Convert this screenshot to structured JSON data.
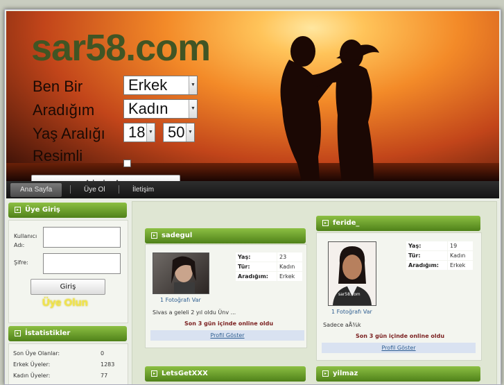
{
  "site": {
    "logo": "sar58.com"
  },
  "search": {
    "ben_bir_label": "Ben Bir",
    "ben_bir_value": "Erkek",
    "aradigim_label": "Aradığım",
    "aradigim_value": "Kadın",
    "yas_label": "Yaş Aralığı",
    "yas_min": "18",
    "yas_max": "50",
    "resimli_label": "Resimli",
    "button_label": "Arkadaş Ara"
  },
  "nav": {
    "items": [
      {
        "label": "Ana Sayfa"
      },
      {
        "label": "Üye Ol"
      },
      {
        "label": "İletişim"
      }
    ]
  },
  "login": {
    "title": "Üye Giriş",
    "username_label": "Kullanıcı Adı:",
    "password_label": "Şifre:",
    "button_label": "Giriş",
    "signup_link": "Üye Olun"
  },
  "stats": {
    "title": "İstatistikler",
    "rows": [
      {
        "label": "Son Üye Olanlar:",
        "value": "0"
      },
      {
        "label": "Erkek Üyeler:",
        "value": "1283"
      },
      {
        "label": "Kadın Üyeler:",
        "value": "77"
      }
    ]
  },
  "profiles": [
    {
      "name": "sadegul",
      "photo_count": "1 Fotoğrafı Var",
      "info": [
        {
          "k": "Yaş:",
          "v": "23"
        },
        {
          "k": "Tür:",
          "v": "Kadın"
        },
        {
          "k": "Aradığım:",
          "v": "Erkek"
        }
      ],
      "bio": "Sivas a geleli 2 yıl oldu Ünv ...",
      "online": "Son 3 gün içinde online oldu",
      "profile_link": "Profil Göster"
    },
    {
      "name": "feride_",
      "photo_count": "1 Fotoğrafı Var",
      "info": [
        {
          "k": "Yaş:",
          "v": "19"
        },
        {
          "k": "Tür:",
          "v": "Kadın"
        },
        {
          "k": "Aradığım:",
          "v": "Erkek"
        }
      ],
      "bio": "Sadece aÅ¾k",
      "online": "Son 3 gün içinde online oldu",
      "profile_link": "Profil Göster",
      "photo_watermark": "sar58.com"
    },
    {
      "name": "LetsGetXXX"
    },
    {
      "name": "yilmaz"
    }
  ],
  "colors": {
    "accent_green": "#6aa22e",
    "logo_green": "#415524",
    "nav_dark": "#1e1e1e",
    "online_red": "#7a1f1f",
    "link_blue": "#2d5d90"
  }
}
